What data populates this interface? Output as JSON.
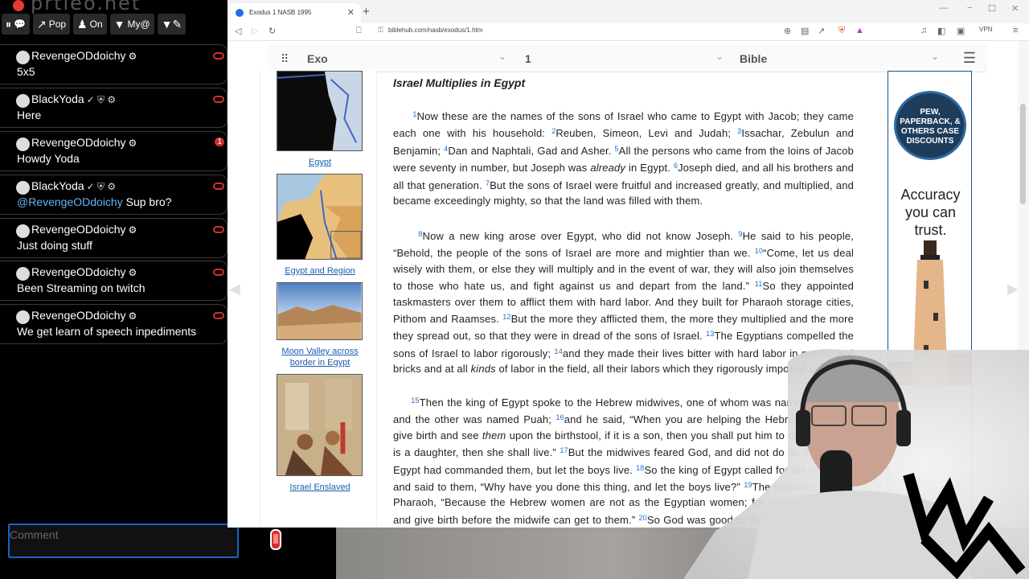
{
  "chat": {
    "logo": "prtleo.net",
    "toolbar": {
      "pause": "⏸",
      "pop_label": "Pop",
      "on_label": "On",
      "my_label": "My@"
    },
    "messages": [
      {
        "user": "RevengeODdoichy",
        "badges": "⚙",
        "text": "5x5",
        "count": ""
      },
      {
        "user": "BlackYoda",
        "badges": "✓ ⛨ ⚙",
        "text": "Here",
        "count": ""
      },
      {
        "user": "RevengeODdoichy",
        "badges": "⚙",
        "text": "Howdy Yoda",
        "count": "1"
      },
      {
        "user": "BlackYoda",
        "badges": "✓ ⛨ ⚙",
        "mention": "@RevengeODdoichy",
        "text": "Sup bro?",
        "count": ""
      },
      {
        "user": "RevengeODdoichy",
        "badges": "⚙",
        "text": "Just doing stuff",
        "count": ""
      },
      {
        "user": "RevengeODdoichy",
        "badges": "⚙",
        "text": "Been Streaming on twitch",
        "count": ""
      },
      {
        "user": "RevengeODdoichy",
        "badges": "⚙",
        "text": "We get learn of speech inpediments",
        "count": ""
      }
    ],
    "comment_placeholder": "Comment"
  },
  "browser": {
    "tab_title": "Exodus 1 NASB 1995",
    "url": "biblehub.com/nasb/exodus/1.htm",
    "vpn_label": "VPN"
  },
  "page": {
    "book_select": "Exo",
    "chapter_select": "1",
    "version_select": "Bible",
    "images": [
      {
        "caption": "Egypt"
      },
      {
        "caption": "Egypt and Region"
      },
      {
        "caption": "Moon Valley across border in Egypt"
      },
      {
        "caption": "Israel Enslaved"
      }
    ],
    "heading": "Israel Multiplies in Egypt",
    "verses": {
      "v1": "Now these are the names of the sons of Israel who came to Egypt with Jacob; they came each one with his household:",
      "v2": "Reuben, Simeon, Levi and Judah;",
      "v3": "Issachar, Zebulun and Benjamin;",
      "v4": "Dan and Naphtali, Gad and Asher.",
      "v5a": "All the persons who came from the loins of Jacob were seventy in number, but Joseph was",
      "v5b": "already",
      "v5c": "in Egypt.",
      "v6": "Joseph died, and all his brothers and all that generation.",
      "v7": "But the sons of Israel were fruitful and increased greatly, and multiplied, and became exceedingly mighty, so that the land was filled with them.",
      "v8": "Now a new king arose over Egypt, who did not know Joseph.",
      "v9": "He said to his people, “Behold, the people of the sons of Israel are more and mightier than we.",
      "v10": "“Come, let us deal wisely with them, or else they will multiply and in the event of war, they will also join themselves to those who hate us, and fight against us and depart from the land.”",
      "v11": "So they appointed taskmasters over them to afflict them with hard labor. And they built for Pharaoh storage cities, Pithom and Raamses.",
      "v12": "But the more they afflicted them, the more they multiplied and the more they spread out, so that they were in dread of the sons of Israel.",
      "v13": "The Egyptians compelled the sons of Israel to labor rigorously;",
      "v14a": "and they made their lives bitter with hard labor in mortar and bricks and at all",
      "v14b": "kinds",
      "v14c": "of labor in the field, all their labors which they rigorously imposed on them.",
      "v15": "Then the king of Egypt spoke to the Hebrew midwives, one of whom was named Shiphrah and the other was named Puah;",
      "v16a": "and he said, “When you are helping the Hebrew women to give birth and see",
      "v16b": "them",
      "v16c": "upon the birthstool, if it is a son, then you shall put him to death; but if it is a daughter, then she shall live.”",
      "v17": "But the midwives feared God, and did not do as the king of Egypt had commanded them, but let the boys live.",
      "v18": "So the king of Egypt called for the midwives and said to them, “Why have you done this thing, and let the boys live?”",
      "v19": "The midwives said to Pharaoh, “Because the Hebrew women are not as the Egyptian women; for they are vigorous and give birth before the midwife can get to them.”",
      "v20": "So God was good to the midwives, and the people multiplied, and became very mighty."
    },
    "ad": {
      "badge": "PEW, PAPERBACK, & OTHERS CASE DISCOUNTS",
      "line1": "Accuracy",
      "line2": "you can",
      "line3": "trust."
    }
  },
  "colors": {
    "link": "#1a5eb0",
    "verse_num": "#1a6fd1",
    "accent_red": "#d32f2f"
  }
}
